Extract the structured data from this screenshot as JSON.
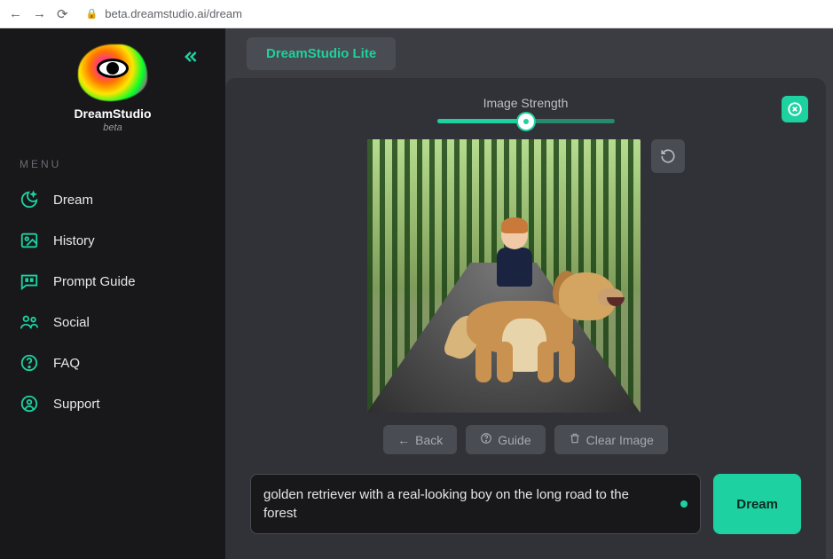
{
  "browser": {
    "url": "beta.dreamstudio.ai/dream"
  },
  "brand": {
    "name": "DreamStudio",
    "subtitle": "beta"
  },
  "sidebar": {
    "menu_heading": "MENU",
    "items": [
      {
        "label": "Dream",
        "icon": "moon-sparkle-icon"
      },
      {
        "label": "History",
        "icon": "image-icon"
      },
      {
        "label": "Prompt Guide",
        "icon": "quote-bubble-icon"
      },
      {
        "label": "Social",
        "icon": "users-icon"
      },
      {
        "label": "FAQ",
        "icon": "question-circle-icon"
      },
      {
        "label": "Support",
        "icon": "globe-person-icon"
      }
    ]
  },
  "topbar": {
    "mode_label": "DreamStudio Lite"
  },
  "workspace": {
    "slider_label": "Image Strength",
    "slider_value_pct": 50,
    "buttons": {
      "back": "Back",
      "guide": "Guide",
      "clear_image": "Clear Image",
      "dream": "Dream"
    },
    "prompt_text": "golden retriever with a real-looking boy on the long road to the forest",
    "image_description": "A golden retriever standing next to a young boy on a long tree-lined forest road"
  },
  "colors": {
    "accent": "#1dd1a1",
    "bg_dark": "#18181b",
    "bg_mid": "#313237",
    "bg_light": "#4a4c53"
  }
}
